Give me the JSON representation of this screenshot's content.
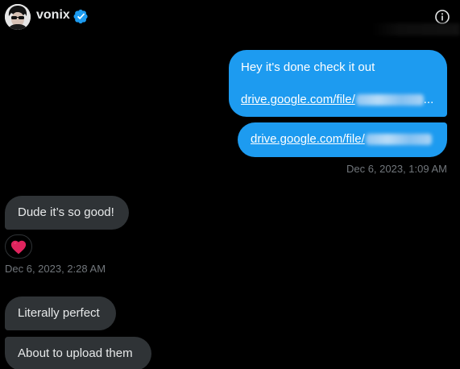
{
  "header": {
    "username": "vonix",
    "verified_icon": "verified-badge-icon",
    "info_icon": "info-icon"
  },
  "messages": {
    "outgoing_1": {
      "text": "Hey it's done check it out",
      "link_text": "drive.google.com/file/",
      "ellipsis": "..."
    },
    "outgoing_2": {
      "link_text": "drive.google.com/file/"
    },
    "outgoing_timestamp": "Dec 6, 2023, 1:09 AM",
    "incoming_1": {
      "text": "Dude it’s so good!",
      "reaction_icon": "red-heart-icon"
    },
    "incoming_timestamp": "Dec 6, 2023, 2:28 AM",
    "incoming_2": {
      "text": "Literally perfect"
    },
    "incoming_3": {
      "text": "About to upload them"
    }
  },
  "colors": {
    "background": "#000000",
    "outgoing_bubble": "#1d9bf0",
    "incoming_bubble": "#2f3336",
    "timestamp": "#71767b",
    "verified": "#1d9bf0",
    "heart": "#f91880"
  }
}
